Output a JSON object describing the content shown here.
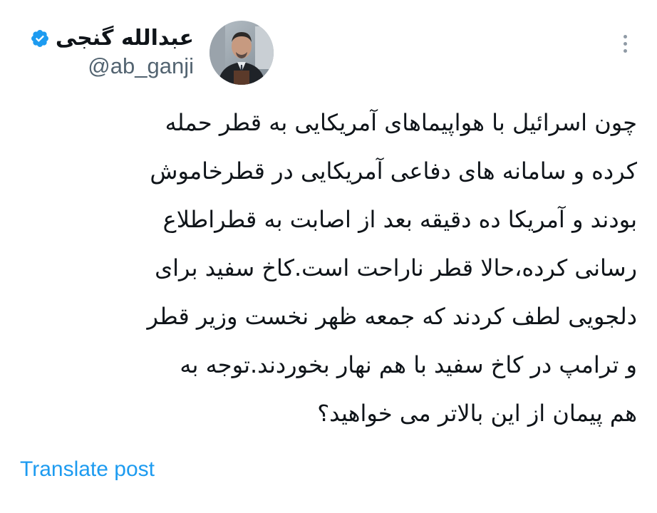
{
  "author": {
    "display_name": "عبدالله گنجی",
    "handle": "@ab_ganji",
    "verified_icon": "verified-badge-icon",
    "avatar_icon": "avatar-photo"
  },
  "post": {
    "lines": [
      "چون اسرائیل با هواپیماهای آمریکایی به قطر حمله",
      "کرده و سامانه های دفاعی آمریکایی در قطرخاموش",
      "بودند و آمریکا ده دقیقه بعد از اصابت به قطراطلاع",
      "رسانی کرده،حالا قطر ناراحت است.کاخ سفید برای",
      "دلجویی لطف کردند که جمعه ظهر نخست وزیر قطر",
      "و ترامپ در کاخ سفید با هم نهار بخوردند.توجه به",
      "هم پیمان از این بالاتر می خواهید؟"
    ],
    "translate_label": "Translate post",
    "more_icon": "more-options-icon"
  },
  "colors": {
    "text": "#0f1419",
    "secondary": "#536471",
    "link": "#1d9bf0",
    "verified": "#1d9bf0",
    "background": "#ffffff"
  }
}
